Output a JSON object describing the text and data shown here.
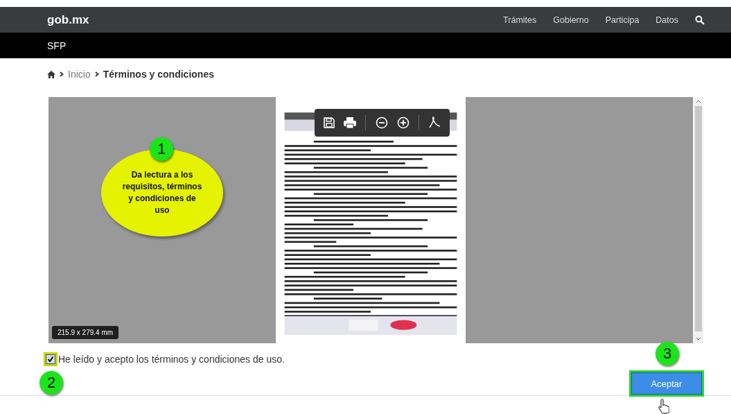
{
  "header": {
    "logo": "gob.mx",
    "nav": [
      {
        "label": "Trámites"
      },
      {
        "label": "Gobierno"
      },
      {
        "label": "Participa"
      },
      {
        "label": "Datos"
      }
    ]
  },
  "subheader": {
    "title": "SFP"
  },
  "breadcrumb": [
    {
      "label": "Inicio",
      "current": false
    },
    {
      "label": "Términos y condiciones",
      "current": true
    }
  ],
  "viewer": {
    "page_size": "215.9 x 279.4 mm"
  },
  "callouts": [
    {
      "number": "1",
      "text": "Da lectura a los requisitos, términos y condiciones de uso"
    },
    {
      "number": "2"
    },
    {
      "number": "3"
    }
  ],
  "agreement": {
    "label": "He leído y acepto los términos y condiciones de uso.",
    "checked": true
  },
  "accept_button": {
    "label": "Aceptar"
  }
}
